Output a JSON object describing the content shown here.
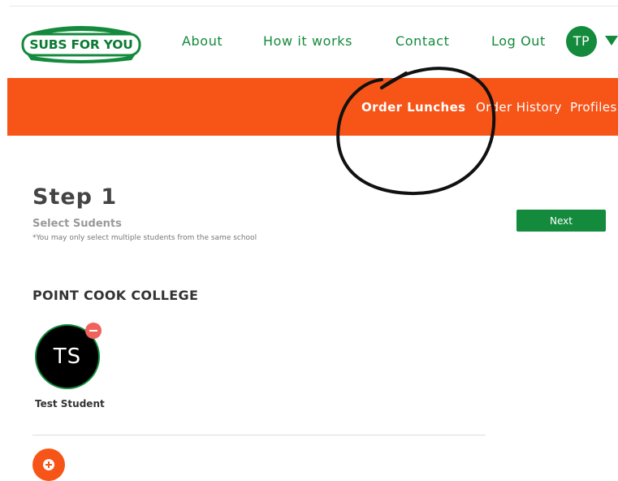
{
  "brand": {
    "logo_text": "SUBS FOR YOU",
    "primary_green": "#138a3c",
    "accent_orange": "#f75418"
  },
  "nav": {
    "links": [
      {
        "label": "About"
      },
      {
        "label": "How it works"
      },
      {
        "label": "Contact"
      },
      {
        "label": "Log Out"
      }
    ],
    "avatar_initials": "TP"
  },
  "subnav": {
    "links": [
      {
        "label": "Order Lunches",
        "active": true
      },
      {
        "label": "Order History",
        "active": false
      },
      {
        "label": "Profiles",
        "active": false
      }
    ]
  },
  "step": {
    "title": "Step 1",
    "subtitle": "Select Sudents",
    "note": "*You may only select multiple students from the same school",
    "next_label": "Next"
  },
  "school": {
    "name": "POINT COOK COLLEGE",
    "students": [
      {
        "initials": "TS",
        "name": "Test Student",
        "selected": true
      }
    ]
  }
}
